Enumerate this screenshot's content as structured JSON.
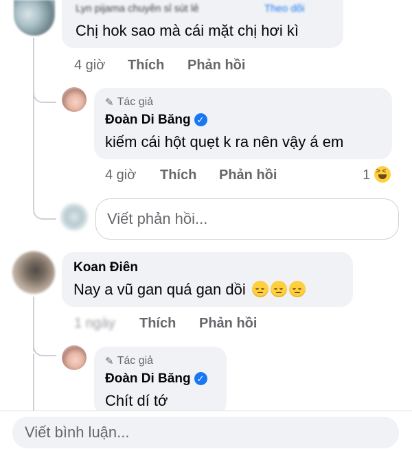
{
  "comment1": {
    "author_blurred": "Lyn pijama chuyên sỉ sút lẻ",
    "follow_blurred": "Theo dõi",
    "text": "Chị hok sao mà cái mặt chị hơi kì",
    "time": "4 giờ",
    "like": "Thích",
    "reply": "Phản hồi"
  },
  "reply1": {
    "author_tag": "Tác giả",
    "author": "Đoàn Di Băng",
    "text": "kiếm cái hột quẹt k ra nên vậy á em",
    "time": "4 giờ",
    "like": "Thích",
    "reply": "Phản hồi",
    "reaction_count": "1",
    "reaction_icon": "haha-emoji-icon"
  },
  "reply_input": {
    "placeholder": "Viết phản hồi..."
  },
  "comment2": {
    "author": "Koan Điên",
    "text": "Nay a vũ gan quá gan dồi",
    "emojis": [
      "relieved-face-icon",
      "relieved-face-icon",
      "relieved-face-icon"
    ],
    "time_blurred": "1 ngày",
    "like": "Thích",
    "reply": "Phản hồi"
  },
  "reply2": {
    "author_tag": "Tác giả",
    "author": "Đoàn Di Băng",
    "text": "Chít dí tớ"
  },
  "bottom_input": {
    "placeholder": "Viết bình luận..."
  },
  "colors": {
    "bubble": "#f0f2f5",
    "meta": "#65676b",
    "verified": "#1877f2",
    "thread_line": "#ccd0d5"
  }
}
